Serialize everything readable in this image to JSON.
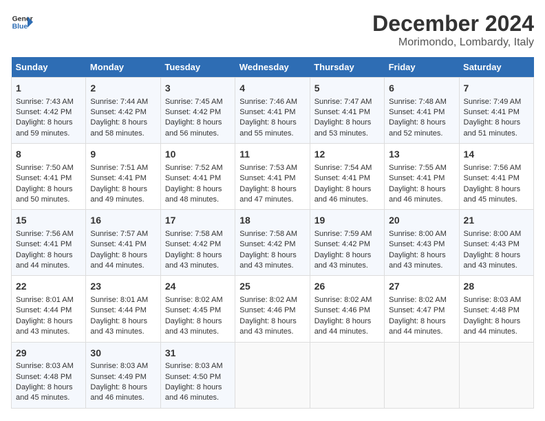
{
  "header": {
    "logo_line1": "General",
    "logo_line2": "Blue",
    "title": "December 2024",
    "subtitle": "Morimondo, Lombardy, Italy"
  },
  "days_of_week": [
    "Sunday",
    "Monday",
    "Tuesday",
    "Wednesday",
    "Thursday",
    "Friday",
    "Saturday"
  ],
  "weeks": [
    [
      {
        "day": "1",
        "lines": [
          "Sunrise: 7:43 AM",
          "Sunset: 4:42 PM",
          "Daylight: 8 hours",
          "and 59 minutes."
        ]
      },
      {
        "day": "2",
        "lines": [
          "Sunrise: 7:44 AM",
          "Sunset: 4:42 PM",
          "Daylight: 8 hours",
          "and 58 minutes."
        ]
      },
      {
        "day": "3",
        "lines": [
          "Sunrise: 7:45 AM",
          "Sunset: 4:42 PM",
          "Daylight: 8 hours",
          "and 56 minutes."
        ]
      },
      {
        "day": "4",
        "lines": [
          "Sunrise: 7:46 AM",
          "Sunset: 4:41 PM",
          "Daylight: 8 hours",
          "and 55 minutes."
        ]
      },
      {
        "day": "5",
        "lines": [
          "Sunrise: 7:47 AM",
          "Sunset: 4:41 PM",
          "Daylight: 8 hours",
          "and 53 minutes."
        ]
      },
      {
        "day": "6",
        "lines": [
          "Sunrise: 7:48 AM",
          "Sunset: 4:41 PM",
          "Daylight: 8 hours",
          "and 52 minutes."
        ]
      },
      {
        "day": "7",
        "lines": [
          "Sunrise: 7:49 AM",
          "Sunset: 4:41 PM",
          "Daylight: 8 hours",
          "and 51 minutes."
        ]
      }
    ],
    [
      {
        "day": "8",
        "lines": [
          "Sunrise: 7:50 AM",
          "Sunset: 4:41 PM",
          "Daylight: 8 hours",
          "and 50 minutes."
        ]
      },
      {
        "day": "9",
        "lines": [
          "Sunrise: 7:51 AM",
          "Sunset: 4:41 PM",
          "Daylight: 8 hours",
          "and 49 minutes."
        ]
      },
      {
        "day": "10",
        "lines": [
          "Sunrise: 7:52 AM",
          "Sunset: 4:41 PM",
          "Daylight: 8 hours",
          "and 48 minutes."
        ]
      },
      {
        "day": "11",
        "lines": [
          "Sunrise: 7:53 AM",
          "Sunset: 4:41 PM",
          "Daylight: 8 hours",
          "and 47 minutes."
        ]
      },
      {
        "day": "12",
        "lines": [
          "Sunrise: 7:54 AM",
          "Sunset: 4:41 PM",
          "Daylight: 8 hours",
          "and 46 minutes."
        ]
      },
      {
        "day": "13",
        "lines": [
          "Sunrise: 7:55 AM",
          "Sunset: 4:41 PM",
          "Daylight: 8 hours",
          "and 46 minutes."
        ]
      },
      {
        "day": "14",
        "lines": [
          "Sunrise: 7:56 AM",
          "Sunset: 4:41 PM",
          "Daylight: 8 hours",
          "and 45 minutes."
        ]
      }
    ],
    [
      {
        "day": "15",
        "lines": [
          "Sunrise: 7:56 AM",
          "Sunset: 4:41 PM",
          "Daylight: 8 hours",
          "and 44 minutes."
        ]
      },
      {
        "day": "16",
        "lines": [
          "Sunrise: 7:57 AM",
          "Sunset: 4:41 PM",
          "Daylight: 8 hours",
          "and 44 minutes."
        ]
      },
      {
        "day": "17",
        "lines": [
          "Sunrise: 7:58 AM",
          "Sunset: 4:42 PM",
          "Daylight: 8 hours",
          "and 43 minutes."
        ]
      },
      {
        "day": "18",
        "lines": [
          "Sunrise: 7:58 AM",
          "Sunset: 4:42 PM",
          "Daylight: 8 hours",
          "and 43 minutes."
        ]
      },
      {
        "day": "19",
        "lines": [
          "Sunrise: 7:59 AM",
          "Sunset: 4:42 PM",
          "Daylight: 8 hours",
          "and 43 minutes."
        ]
      },
      {
        "day": "20",
        "lines": [
          "Sunrise: 8:00 AM",
          "Sunset: 4:43 PM",
          "Daylight: 8 hours",
          "and 43 minutes."
        ]
      },
      {
        "day": "21",
        "lines": [
          "Sunrise: 8:00 AM",
          "Sunset: 4:43 PM",
          "Daylight: 8 hours",
          "and 43 minutes."
        ]
      }
    ],
    [
      {
        "day": "22",
        "lines": [
          "Sunrise: 8:01 AM",
          "Sunset: 4:44 PM",
          "Daylight: 8 hours",
          "and 43 minutes."
        ]
      },
      {
        "day": "23",
        "lines": [
          "Sunrise: 8:01 AM",
          "Sunset: 4:44 PM",
          "Daylight: 8 hours",
          "and 43 minutes."
        ]
      },
      {
        "day": "24",
        "lines": [
          "Sunrise: 8:02 AM",
          "Sunset: 4:45 PM",
          "Daylight: 8 hours",
          "and 43 minutes."
        ]
      },
      {
        "day": "25",
        "lines": [
          "Sunrise: 8:02 AM",
          "Sunset: 4:46 PM",
          "Daylight: 8 hours",
          "and 43 minutes."
        ]
      },
      {
        "day": "26",
        "lines": [
          "Sunrise: 8:02 AM",
          "Sunset: 4:46 PM",
          "Daylight: 8 hours",
          "and 44 minutes."
        ]
      },
      {
        "day": "27",
        "lines": [
          "Sunrise: 8:02 AM",
          "Sunset: 4:47 PM",
          "Daylight: 8 hours",
          "and 44 minutes."
        ]
      },
      {
        "day": "28",
        "lines": [
          "Sunrise: 8:03 AM",
          "Sunset: 4:48 PM",
          "Daylight: 8 hours",
          "and 44 minutes."
        ]
      }
    ],
    [
      {
        "day": "29",
        "lines": [
          "Sunrise: 8:03 AM",
          "Sunset: 4:48 PM",
          "Daylight: 8 hours",
          "and 45 minutes."
        ]
      },
      {
        "day": "30",
        "lines": [
          "Sunrise: 8:03 AM",
          "Sunset: 4:49 PM",
          "Daylight: 8 hours",
          "and 46 minutes."
        ]
      },
      {
        "day": "31",
        "lines": [
          "Sunrise: 8:03 AM",
          "Sunset: 4:50 PM",
          "Daylight: 8 hours",
          "and 46 minutes."
        ]
      },
      null,
      null,
      null,
      null
    ]
  ]
}
